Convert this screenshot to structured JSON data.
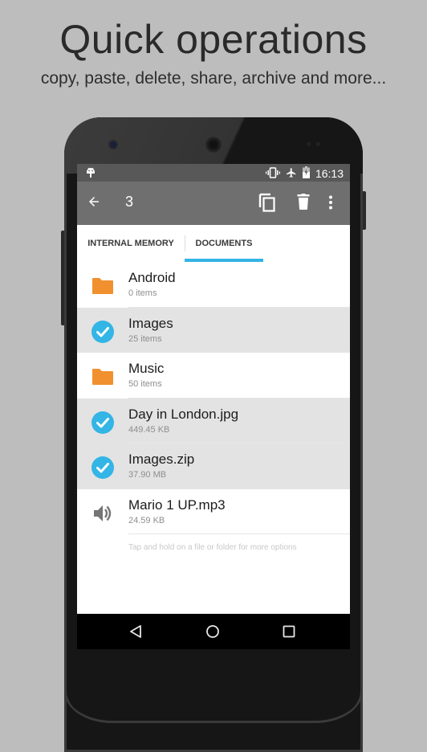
{
  "promo": {
    "title": "Quick operations",
    "subtitle": "copy, paste, delete, share, archive and more..."
  },
  "statusbar": {
    "notification_icon": "android-icon",
    "icons": [
      "vibrate-icon",
      "airplane-mode-icon",
      "battery-charging-icon"
    ],
    "time": "16:13"
  },
  "toolbar": {
    "back_icon": "arrow-left-icon",
    "selected_count": "3",
    "actions": [
      "copy-icon",
      "delete-icon",
      "more-vert-icon"
    ]
  },
  "tabs": [
    {
      "label": "INTERNAL MEMORY",
      "active": false
    },
    {
      "label": "DOCUMENTS",
      "active": true
    }
  ],
  "accent_color": "#33b5e5",
  "folder_color": "#f0902e",
  "files": [
    {
      "name": "Android",
      "meta": "0 items",
      "type": "folder",
      "selected": false
    },
    {
      "name": "Images",
      "meta": "25 items",
      "type": "folder",
      "selected": true
    },
    {
      "name": "Music",
      "meta": "50 items",
      "type": "folder",
      "selected": false
    },
    {
      "name": "Day in London.jpg",
      "meta": "449.45 KB",
      "type": "image",
      "selected": true
    },
    {
      "name": "Images.zip",
      "meta": "37.90 MB",
      "type": "archive",
      "selected": true
    },
    {
      "name": "Mario 1 UP.mp3",
      "meta": "24.59 KB",
      "type": "audio",
      "selected": false
    }
  ],
  "hint": "Tap and hold on a file or folder for more options",
  "navbar": [
    "back-nav-icon",
    "home-nav-icon",
    "recents-nav-icon"
  ]
}
